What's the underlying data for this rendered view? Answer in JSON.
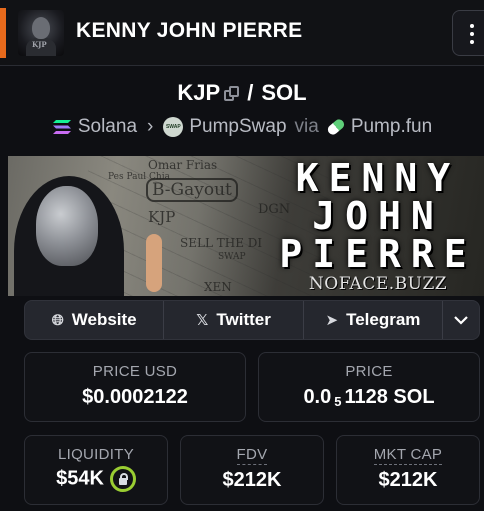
{
  "header": {
    "token_name": "KENNY JOHN PIERRE",
    "avatar_text": "KJP"
  },
  "pair": {
    "base": "KJP",
    "separator": "/",
    "quote": "SOL"
  },
  "route": {
    "chain": "Solana",
    "dex": "PumpSwap",
    "via": "via",
    "launchpad": "Pump.fun"
  },
  "banner": {
    "title_line1": "KENNY",
    "title_line2": "JOHN",
    "title_line3": "PIERRE",
    "site": "NOFACE.BUZZ",
    "scribbles": [
      "Omar Frias",
      "B-Gayout",
      "Pes Paul Chia",
      "KJP",
      "SELL THE DI",
      "DGN",
      "SWAP",
      "XEN"
    ]
  },
  "links": {
    "website": "Website",
    "twitter": "Twitter",
    "telegram": "Telegram"
  },
  "stats": {
    "price_usd_label": "PRICE USD",
    "price_usd_value": "$0.0002122",
    "price_label": "PRICE",
    "price_value_prefix": "0.0",
    "price_value_sub": "5",
    "price_value_suffix": "1128 SOL",
    "liquidity_label": "LIQUIDITY",
    "liquidity_value": "$54K",
    "fdv_label": "FDV",
    "fdv_value": "$212K",
    "mktcap_label": "MKT CAP",
    "mktcap_value": "$212K"
  },
  "colors": {
    "accent": "#e86a1c",
    "lock_ring": "#9acd32",
    "background": "#0e0f13"
  }
}
